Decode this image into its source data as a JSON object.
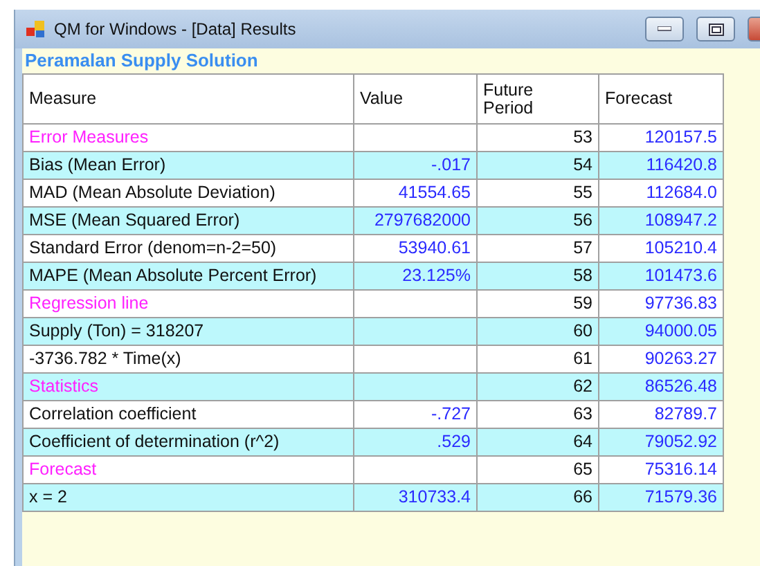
{
  "window": {
    "title": "QM for Windows - [Data] Results"
  },
  "heading": "Peramalan Supply Solution",
  "table": {
    "columns": [
      "Measure",
      "Value",
      "Future Period",
      "Forecast"
    ],
    "rows": [
      {
        "kind": "section",
        "measure": "Error Measures",
        "period": "53",
        "forecast": "120157.5"
      },
      {
        "kind": "item",
        "measure": "Bias (Mean Error)",
        "value": "-.017",
        "period": "54",
        "forecast": "116420.8"
      },
      {
        "kind": "item",
        "measure": "MAD (Mean Absolute Deviation)",
        "value": "41554.65",
        "period": "55",
        "forecast": "112684.0"
      },
      {
        "kind": "item",
        "measure": "MSE (Mean Squared Error)",
        "value": "2797682000",
        "period": "56",
        "forecast": "108947.2"
      },
      {
        "kind": "item",
        "measure": "Standard Error (denom=n-2=50)",
        "value": "53940.61",
        "period": "57",
        "forecast": "105210.4"
      },
      {
        "kind": "item",
        "measure": "MAPE (Mean Absolute Percent Error)",
        "value": "23.125%",
        "period": "58",
        "forecast": "101473.6"
      },
      {
        "kind": "section",
        "measure": "Regression line",
        "period": "59",
        "forecast": "97736.83"
      },
      {
        "kind": "item",
        "measure": "Supply (Ton) = 318207",
        "period": "60",
        "forecast": "94000.05"
      },
      {
        "kind": "item",
        "measure": "-3736.782 * Time(x)",
        "period": "61",
        "forecast": "90263.27"
      },
      {
        "kind": "section",
        "measure": "Statistics",
        "period": "62",
        "forecast": "86526.48"
      },
      {
        "kind": "item",
        "measure": "Correlation coefficient",
        "value": "-.727",
        "period": "63",
        "forecast": "82789.7"
      },
      {
        "kind": "item",
        "measure": "Coefficient of determination (r^2)",
        "value": ".529",
        "period": "64",
        "forecast": "79052.92"
      },
      {
        "kind": "section",
        "measure": "Forecast",
        "period": "65",
        "forecast": "75316.14"
      },
      {
        "kind": "item",
        "measure": "x = 2",
        "value": "310733.4",
        "period": "66",
        "forecast": "71579.36"
      }
    ]
  }
}
